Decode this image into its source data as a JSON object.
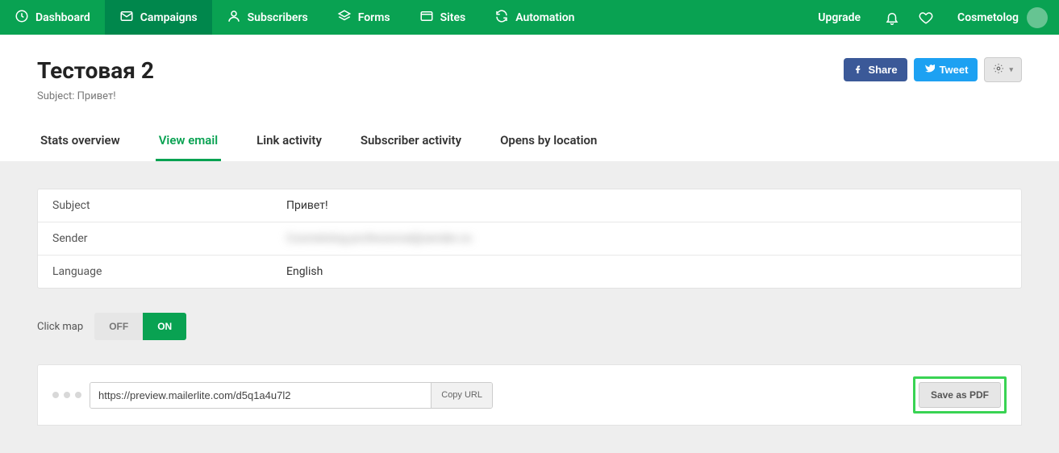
{
  "nav": {
    "dashboard": "Dashboard",
    "campaigns": "Campaigns",
    "subscribers": "Subscribers",
    "forms": "Forms",
    "sites": "Sites",
    "automation": "Automation",
    "upgrade": "Upgrade",
    "user": "Cosmetolog"
  },
  "page": {
    "title": "Тестовая 2",
    "subject_label": "Subject:",
    "subject_value": "Привет!"
  },
  "actions": {
    "share": "Share",
    "tweet": "Tweet"
  },
  "tabs": {
    "stats": "Stats overview",
    "view_email": "View email",
    "link_activity": "Link activity",
    "subscriber_activity": "Subscriber activity",
    "opens_location": "Opens by location"
  },
  "info": {
    "subject_label": "Subject",
    "subject_value": "Привет!",
    "sender_label": "Sender",
    "sender_value": "Cosmetolog-professional@sender.co",
    "language_label": "Language",
    "language_value": "English"
  },
  "clickmap": {
    "label": "Click map",
    "off": "OFF",
    "on": "ON"
  },
  "preview": {
    "url": "https://preview.mailerlite.com/d5q1a4u7l2",
    "copy": "Copy URL",
    "save_pdf": "Save as PDF"
  }
}
